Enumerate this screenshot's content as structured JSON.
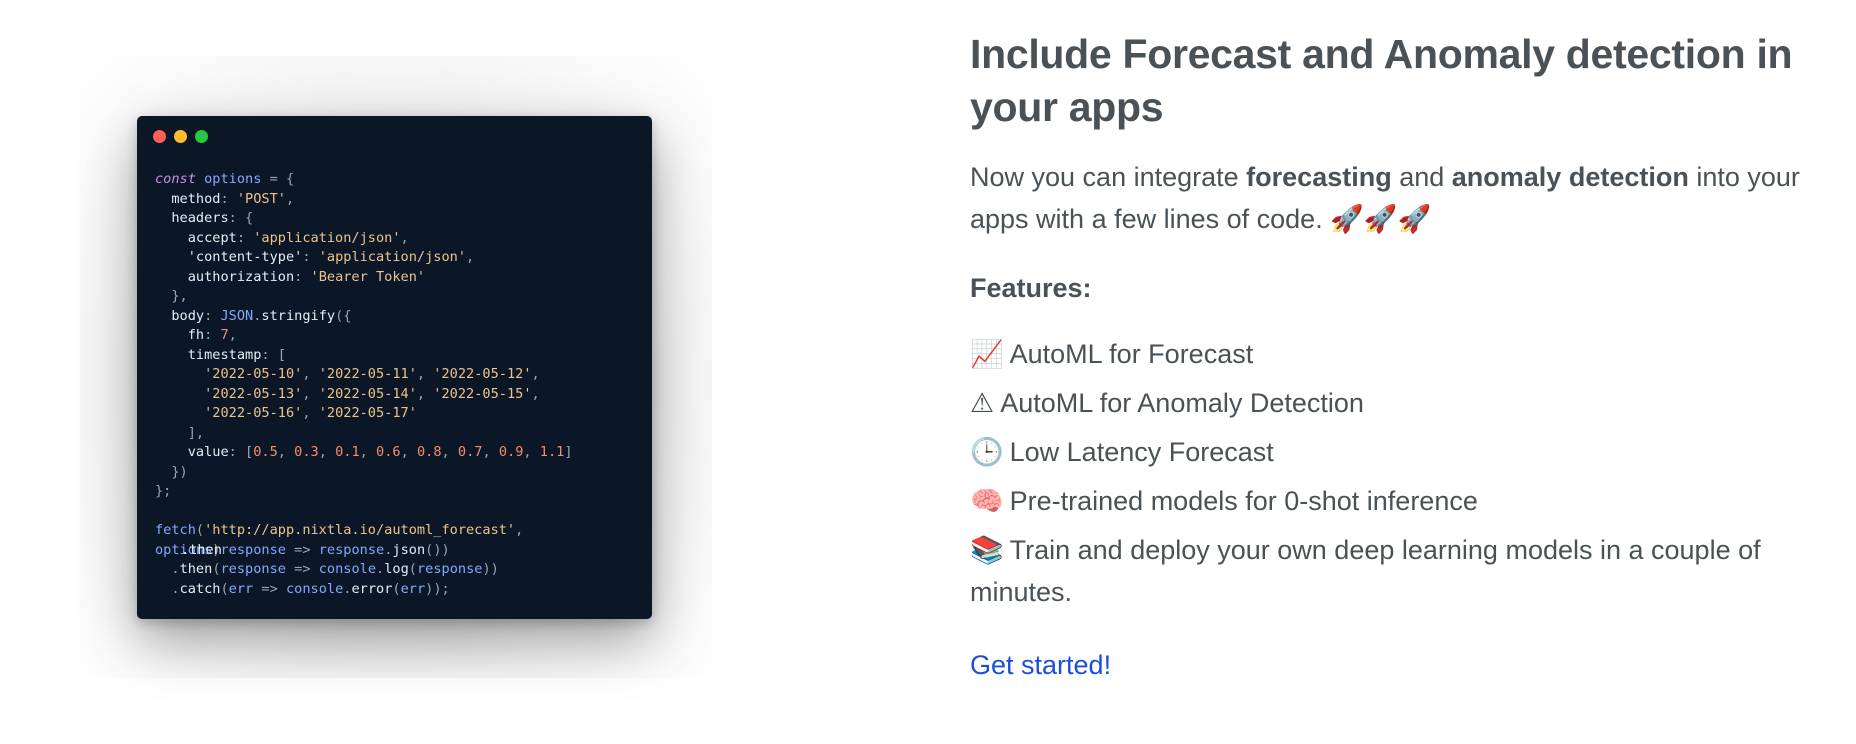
{
  "code_card": {
    "lines": [
      {
        "tokens": [
          {
            "c": "kw",
            "t": "const"
          },
          {
            "c": "var",
            "t": " options"
          },
          {
            "c": "pun",
            "t": " = {"
          }
        ]
      },
      {
        "tokens": [
          {
            "c": "prop",
            "t": "  method"
          },
          {
            "c": "pun",
            "t": ": "
          },
          {
            "c": "str",
            "t": "'POST'"
          },
          {
            "c": "pun",
            "t": ","
          }
        ]
      },
      {
        "tokens": [
          {
            "c": "prop",
            "t": "  headers"
          },
          {
            "c": "pun",
            "t": ": {"
          }
        ]
      },
      {
        "tokens": [
          {
            "c": "prop",
            "t": "    accept"
          },
          {
            "c": "pun",
            "t": ": "
          },
          {
            "c": "str",
            "t": "'application/json'"
          },
          {
            "c": "pun",
            "t": ","
          }
        ]
      },
      {
        "tokens": [
          {
            "c": "prop",
            "t": "    'content-type'"
          },
          {
            "c": "pun",
            "t": ": "
          },
          {
            "c": "str",
            "t": "'application/json'"
          },
          {
            "c": "pun",
            "t": ","
          }
        ]
      },
      {
        "tokens": [
          {
            "c": "prop",
            "t": "    authorization"
          },
          {
            "c": "pun",
            "t": ": "
          },
          {
            "c": "str",
            "t": "'Bearer Token'"
          }
        ]
      },
      {
        "tokens": [
          {
            "c": "pun",
            "t": "  },"
          }
        ]
      },
      {
        "tokens": [
          {
            "c": "prop",
            "t": "  body"
          },
          {
            "c": "pun",
            "t": ": "
          },
          {
            "c": "fn",
            "t": "JSON"
          },
          {
            "c": "pun",
            "t": "."
          },
          {
            "c": "prop",
            "t": "stringify"
          },
          {
            "c": "pun",
            "t": "({"
          }
        ]
      },
      {
        "tokens": [
          {
            "c": "prop",
            "t": "    fh"
          },
          {
            "c": "pun",
            "t": ": "
          },
          {
            "c": "num",
            "t": "7"
          },
          {
            "c": "pun",
            "t": ","
          }
        ]
      },
      {
        "tokens": [
          {
            "c": "prop",
            "t": "    timestamp"
          },
          {
            "c": "pun",
            "t": ": ["
          }
        ]
      },
      {
        "tokens": [
          {
            "c": "str",
            "t": "      '2022-05-10'"
          },
          {
            "c": "pun",
            "t": ", "
          },
          {
            "c": "str",
            "t": "'2022-05-11'"
          },
          {
            "c": "pun",
            "t": ", "
          },
          {
            "c": "str",
            "t": "'2022-05-12'"
          },
          {
            "c": "pun",
            "t": ","
          }
        ]
      },
      {
        "tokens": [
          {
            "c": "str",
            "t": "      '2022-05-13'"
          },
          {
            "c": "pun",
            "t": ", "
          },
          {
            "c": "str",
            "t": "'2022-05-14'"
          },
          {
            "c": "pun",
            "t": ", "
          },
          {
            "c": "str",
            "t": "'2022-05-15'"
          },
          {
            "c": "pun",
            "t": ","
          }
        ]
      },
      {
        "tokens": [
          {
            "c": "str",
            "t": "      '2022-05-16'"
          },
          {
            "c": "pun",
            "t": ", "
          },
          {
            "c": "str",
            "t": "'2022-05-17'"
          }
        ]
      },
      {
        "tokens": [
          {
            "c": "pun",
            "t": "    ],"
          }
        ]
      },
      {
        "tokens": [
          {
            "c": "prop",
            "t": "    value"
          },
          {
            "c": "pun",
            "t": ": ["
          },
          {
            "c": "num",
            "t": "0.5"
          },
          {
            "c": "pun",
            "t": ", "
          },
          {
            "c": "num",
            "t": "0.3"
          },
          {
            "c": "pun",
            "t": ", "
          },
          {
            "c": "num",
            "t": "0.1"
          },
          {
            "c": "pun",
            "t": ", "
          },
          {
            "c": "num",
            "t": "0.6"
          },
          {
            "c": "pun",
            "t": ", "
          },
          {
            "c": "num",
            "t": "0.8"
          },
          {
            "c": "pun",
            "t": ", "
          },
          {
            "c": "num",
            "t": "0.7"
          },
          {
            "c": "pun",
            "t": ", "
          },
          {
            "c": "num",
            "t": "0.9"
          },
          {
            "c": "pun",
            "t": ", "
          },
          {
            "c": "num",
            "t": "1.1"
          },
          {
            "c": "pun",
            "t": "]"
          }
        ]
      },
      {
        "tokens": [
          {
            "c": "pun",
            "t": "  })"
          }
        ]
      },
      {
        "tokens": [
          {
            "c": "pun",
            "t": "};"
          }
        ]
      },
      {
        "tokens": [
          {
            "c": "pun",
            "t": " "
          }
        ]
      },
      {
        "tokens": [
          {
            "c": "fn",
            "t": "fetch"
          },
          {
            "c": "pun",
            "t": "("
          },
          {
            "c": "str",
            "t": "'http://app.nixtla.io/automl_forecast'"
          },
          {
            "c": "pun",
            "t": ","
          }
        ]
      },
      {
        "tokens": [
          {
            "c": "var",
            "t": "options"
          },
          {
            "c": "pun",
            "t": ")"
          },
          {
            "c": "var",
            "t": "response"
          },
          {
            "c": "pun",
            "t": " => "
          },
          {
            "c": "var",
            "t": "response"
          },
          {
            "c": "pun",
            "t": "."
          },
          {
            "c": "prop",
            "t": "json"
          },
          {
            "c": "pun",
            "t": "())"
          }
        ],
        "overlay": ".then"
      },
      {
        "tokens": [
          {
            "c": "pun",
            "t": "  ."
          },
          {
            "c": "prop",
            "t": "then"
          },
          {
            "c": "pun",
            "t": "("
          },
          {
            "c": "var",
            "t": "response"
          },
          {
            "c": "pun",
            "t": " => "
          },
          {
            "c": "var",
            "t": "console"
          },
          {
            "c": "pun",
            "t": "."
          },
          {
            "c": "prop",
            "t": "log"
          },
          {
            "c": "pun",
            "t": "("
          },
          {
            "c": "var",
            "t": "response"
          },
          {
            "c": "pun",
            "t": "))"
          }
        ]
      },
      {
        "tokens": [
          {
            "c": "pun",
            "t": "  ."
          },
          {
            "c": "prop",
            "t": "catch"
          },
          {
            "c": "pun",
            "t": "("
          },
          {
            "c": "var",
            "t": "err"
          },
          {
            "c": "pun",
            "t": " => "
          },
          {
            "c": "var",
            "t": "console"
          },
          {
            "c": "pun",
            "t": "."
          },
          {
            "c": "prop",
            "t": "error"
          },
          {
            "c": "pun",
            "t": "("
          },
          {
            "c": "var",
            "t": "err"
          },
          {
            "c": "pun",
            "t": "));"
          }
        ]
      }
    ]
  },
  "section": {
    "title": "Include Forecast and Anomaly detection in your apps",
    "desc_pre": "Now you can integrate ",
    "desc_bold1": "forecasting",
    "desc_mid": " and ",
    "desc_bold2": "anomaly detection",
    "desc_post": " into your apps with a few lines of code. 🚀🚀🚀",
    "features_title": "Features:",
    "features": [
      {
        "icon": "📈",
        "icon_name": "chart-increasing-icon",
        "text": "AutoML for Forecast"
      },
      {
        "icon": "⚠",
        "icon_name": "warning-icon",
        "text": "AutoML for Anomaly Detection"
      },
      {
        "icon": "🕒",
        "icon_name": "clock-icon",
        "text": "Low Latency Forecast"
      },
      {
        "icon": "🧠",
        "icon_name": "brain-icon",
        "text": "Pre-trained models for 0-shot inference"
      },
      {
        "icon": "📚",
        "icon_name": "books-icon",
        "text": "Train and deploy your own deep learning models in a couple of minutes."
      }
    ],
    "cta": "Get started!"
  }
}
